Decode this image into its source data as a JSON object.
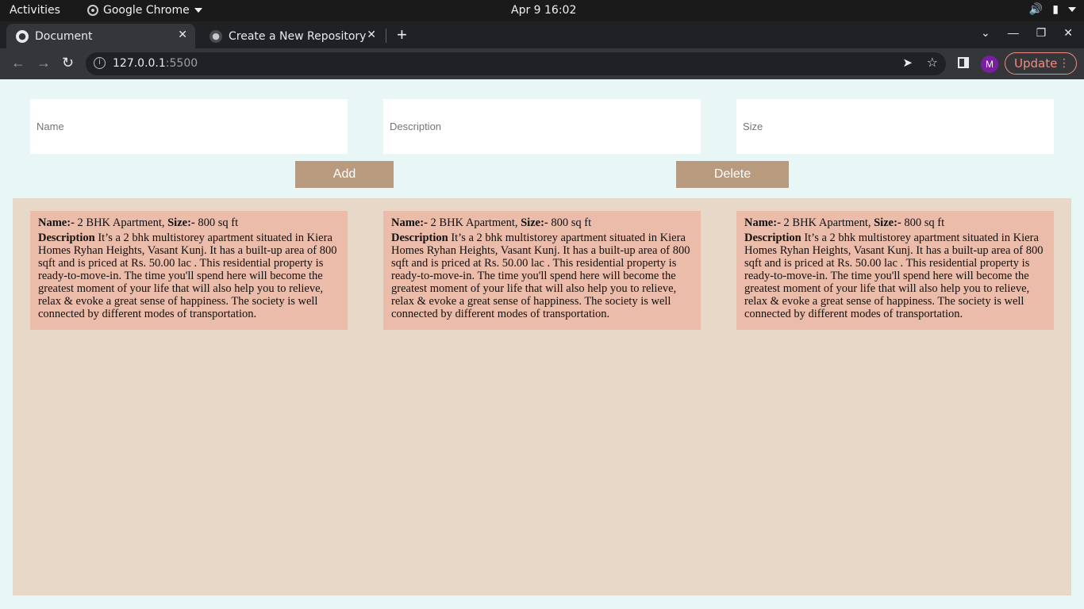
{
  "system": {
    "activities": "Activities",
    "app_name": "Google Chrome",
    "clock": "Apr 9  16:02"
  },
  "tabs": [
    {
      "title": "Document",
      "active": true
    },
    {
      "title": "Create a New Repository",
      "active": false
    }
  ],
  "omnibox": {
    "host": "127.0.0.1",
    "port": ":5500"
  },
  "profile": {
    "initial": "M"
  },
  "update_label": "Update",
  "form": {
    "name_placeholder": "Name",
    "description_placeholder": "Description",
    "size_placeholder": "Size",
    "add_label": "Add",
    "delete_label": "Delete"
  },
  "cards": [
    {
      "name_label": "Name:-",
      "name": " 2 BHK Apartment, ",
      "size_label": "Size:-",
      "size": " 800 sq ft",
      "desc_label": "Description",
      "description": " It’s a 2 bhk multistorey apartment situated in Kiera Homes Ryhan Heights, Vasant Kunj. It has a built-up area of 800 sqft and is priced at Rs. 50.00 lac . This residential property is ready-to-move-in. The time you'll spend here will become the greatest moment of your life that will also help you to relieve, relax & evoke a great sense of happiness. The society is well connected by different modes of transportation."
    },
    {
      "name_label": "Name:-",
      "name": " 2 BHK Apartment, ",
      "size_label": "Size:-",
      "size": " 800 sq ft",
      "desc_label": "Description",
      "description": " It’s a 2 bhk multistorey apartment situated in Kiera Homes Ryhan Heights, Vasant Kunj. It has a built-up area of 800 sqft and is priced at Rs. 50.00 lac . This residential property is ready-to-move-in. The time you'll spend here will become the greatest moment of your life that will also help you to relieve, relax & evoke a great sense of happiness. The society is well connected by different modes of transportation."
    },
    {
      "name_label": "Name:-",
      "name": " 2 BHK Apartment, ",
      "size_label": "Size:-",
      "size": " 800 sq ft",
      "desc_label": "Description",
      "description": " It’s a 2 bhk multistorey apartment situated in Kiera Homes Ryhan Heights, Vasant Kunj. It has a built-up area of 800 sqft and is priced at Rs. 50.00 lac . This residential property is ready-to-move-in. The time you'll spend here will become the greatest moment of your life that will also help you to relieve, relax & evoke a great sense of happiness. The society is well connected by different modes of transportation."
    }
  ]
}
